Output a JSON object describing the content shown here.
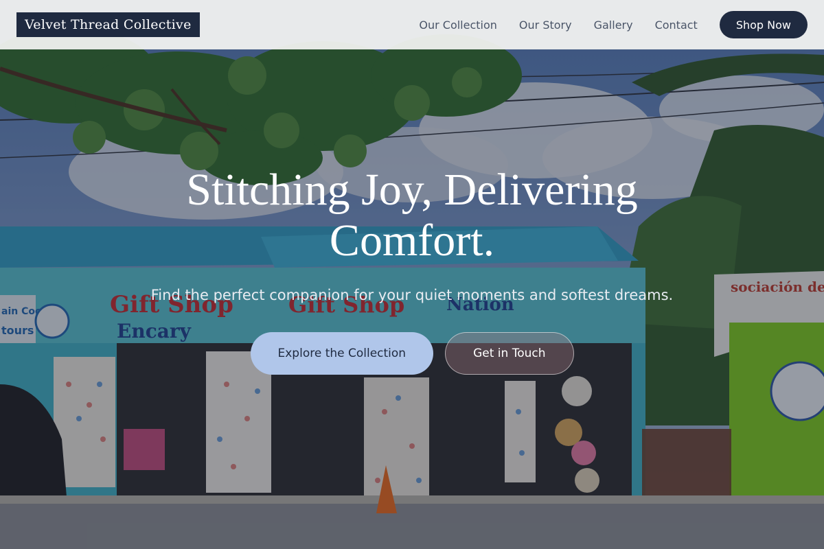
{
  "brand": {
    "name": "Velvet Thread Collective"
  },
  "nav": {
    "links": [
      "Our Collection",
      "Our Story",
      "Gallery",
      "Contact"
    ],
    "cta_label": "Shop Now"
  },
  "hero": {
    "title": "Stitching Joy, Delivering Comfort.",
    "subtitle": "Find the perfect companion for your quiet moments and softest dreams.",
    "primary_label": "Explore the Collection",
    "secondary_label": "Get in Touch",
    "background_description_icon": "gift-shop-street-photo",
    "shop_sign_texts": [
      "Gift Shop",
      "Encary",
      "Gift Shop",
      "Nation",
      "ain Coco",
      "tours",
      "sociación de tr"
    ]
  },
  "colors": {
    "brand_bg": "#1f2a40",
    "nav_text": "#4a5568",
    "primary_btn": "#b0c6ea",
    "header_bg": "#f5f5f3"
  }
}
